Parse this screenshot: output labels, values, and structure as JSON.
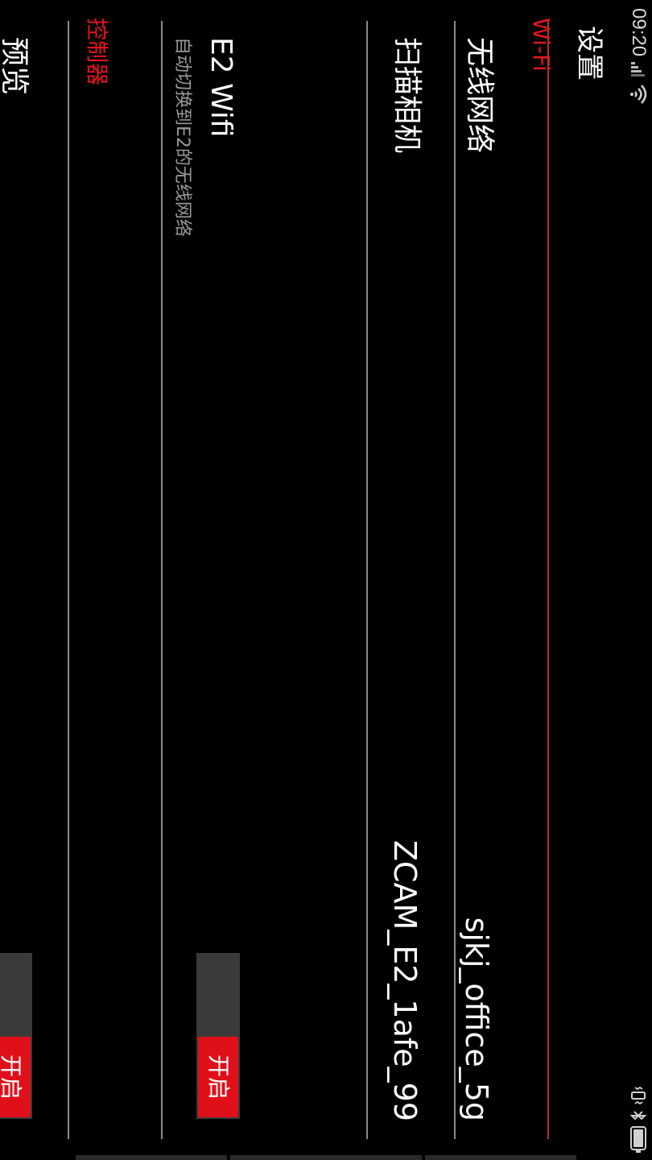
{
  "status_bar": {
    "time": "09:20",
    "icons": [
      "signal-icon",
      "wifi-icon",
      "vibrate-icon",
      "bluetooth-icon",
      "battery-icon"
    ]
  },
  "header": {
    "title": "设置"
  },
  "sections": {
    "wifi": {
      "header": "Wi-Fi",
      "rows": [
        {
          "title": "无线网络",
          "value": "sjkj_office_5g"
        },
        {
          "title": "扫描相机",
          "value": "ZCAM_E2_1afe_99"
        },
        {
          "title": "E2 Wifi",
          "summary": "自动切换到E2的无线网络",
          "toggle": "开启"
        }
      ]
    },
    "controller": {
      "header": "控制器",
      "rows": [
        {
          "title": "预览",
          "toggle": "开启"
        }
      ]
    }
  },
  "colors": {
    "accent": "#e8141e",
    "background": "#000000",
    "divider": "#8a8a8a",
    "section_rule": "#b3302c",
    "toggle_track": "#3a3a3a",
    "summary_text": "#9a9a9a"
  }
}
